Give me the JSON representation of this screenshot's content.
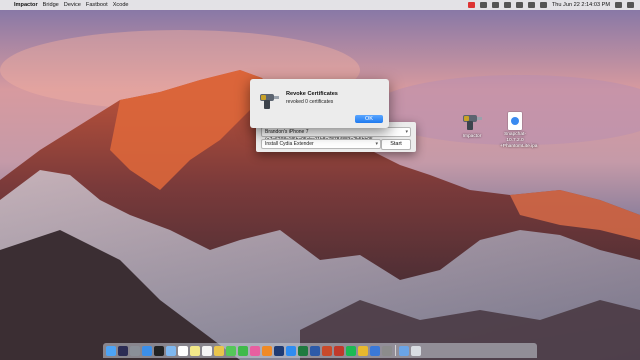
{
  "menubar": {
    "apple": "",
    "menus": [
      "Impactor",
      "Bridge",
      "Device",
      "Fastboot",
      "Xcode"
    ],
    "clock": "Thu Jun 22  2:14:03 PM"
  },
  "alert": {
    "title": "Revoke Certificates",
    "message": "revoked 0 certificates",
    "ok_label": "OK"
  },
  "impactor_window": {
    "device": "Brandon's iPhone 7 (a7e6298c1f6ba05cbe11b8e78784883e2b5bb05",
    "command": "Install Cydia Extender",
    "start_label": "Start"
  },
  "desktop_icons": [
    {
      "name": "Impactor",
      "icon": "drill-icon"
    },
    {
      "name": "Snapchat-10.7.2.0-+PhantomLite.ipa",
      "label_line1": "Snapchat-10.7.2.0",
      "label_line2": "+PhantomLite.ipa",
      "icon": "ipa-file-icon"
    }
  ],
  "dock_apps": [
    {
      "name": "finder",
      "color": "#4da3f5"
    },
    {
      "name": "siri",
      "color": "#2c2c54"
    },
    {
      "name": "launchpad",
      "color": "#8a8f98"
    },
    {
      "name": "safari",
      "color": "#3b8ee8"
    },
    {
      "name": "terminal",
      "color": "#222222"
    },
    {
      "name": "mail",
      "color": "#7fb8f0"
    },
    {
      "name": "calendar",
      "color": "#ffffff"
    },
    {
      "name": "notes",
      "color": "#f3e98a"
    },
    {
      "name": "reminders",
      "color": "#f5f5f5"
    },
    {
      "name": "photos",
      "color": "#e9c44c"
    },
    {
      "name": "messages",
      "color": "#54c759"
    },
    {
      "name": "facetime",
      "color": "#3fba4b"
    },
    {
      "name": "itunes",
      "color": "#e85fa0"
    },
    {
      "name": "ibooks",
      "color": "#f08a25"
    },
    {
      "name": "photoshop",
      "color": "#1f3b73"
    },
    {
      "name": "app-store",
      "color": "#2f8cf0"
    },
    {
      "name": "excel",
      "color": "#1f7a3f"
    },
    {
      "name": "word",
      "color": "#2c5aa8"
    },
    {
      "name": "powerpoint",
      "color": "#c94a2a"
    },
    {
      "name": "photo-booth",
      "color": "#c0392b"
    },
    {
      "name": "spotify",
      "color": "#1db954"
    },
    {
      "name": "chrome",
      "color": "#e8b92e"
    },
    {
      "name": "xcode",
      "color": "#3a79d8"
    },
    {
      "name": "system-preferences",
      "color": "#8c8c8c"
    },
    {
      "name": "downloads",
      "color": "#6aa4e6"
    },
    {
      "name": "trash",
      "color": "#d9dde3"
    }
  ]
}
